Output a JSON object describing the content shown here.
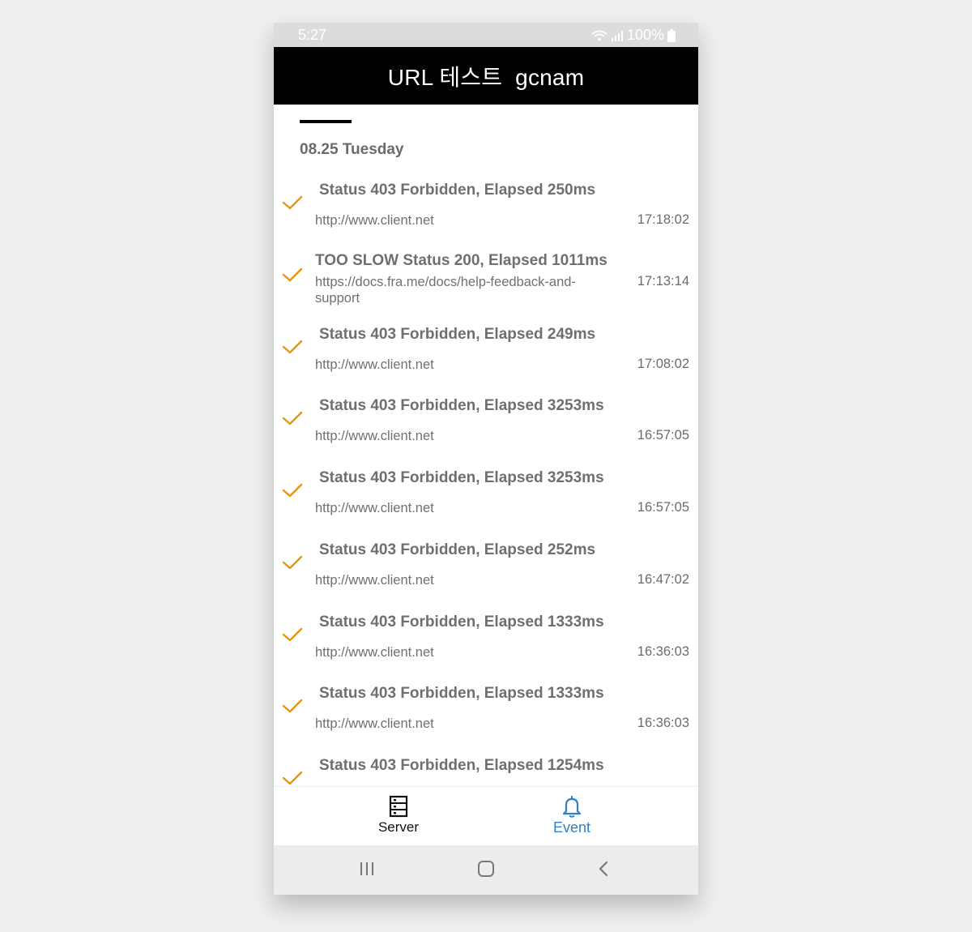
{
  "status_bar": {
    "time": "5:27",
    "battery": "100%"
  },
  "header": {
    "title": "URL 테스트  gcnam"
  },
  "date_header": "08.25 Tuesday",
  "events": [
    {
      "title": "Status 403 Forbidden, Elapsed 250ms",
      "url": "http://www.client.net",
      "time": "17:18:02"
    },
    {
      "title": "TOO SLOW Status 200, Elapsed 1011ms",
      "url": "https://docs.fra.me/docs/help-feedback-and-support",
      "time": "17:13:14"
    },
    {
      "title": "Status 403 Forbidden, Elapsed 249ms",
      "url": "http://www.client.net",
      "time": "17:08:02"
    },
    {
      "title": "Status 403 Forbidden, Elapsed 3253ms",
      "url": "http://www.client.net",
      "time": "16:57:05"
    },
    {
      "title": "Status 403 Forbidden, Elapsed 3253ms",
      "url": "http://www.client.net",
      "time": "16:57:05"
    },
    {
      "title": "Status 403 Forbidden, Elapsed 252ms",
      "url": "http://www.client.net",
      "time": "16:47:02"
    },
    {
      "title": "Status 403 Forbidden, Elapsed 1333ms",
      "url": "http://www.client.net",
      "time": "16:36:03"
    },
    {
      "title": "Status 403 Forbidden, Elapsed 1333ms",
      "url": "http://www.client.net",
      "time": "16:36:03"
    },
    {
      "title": "Status 403 Forbidden, Elapsed 1254ms",
      "url": "",
      "time": ""
    }
  ],
  "bottom_nav": {
    "server_label": "Server",
    "event_label": "Event",
    "active": "Event"
  },
  "colors": {
    "check": "#e8950f",
    "accent": "#2d82c8",
    "header_bg": "#000000"
  },
  "icons": {
    "check": "check-icon",
    "server": "server-icon",
    "event": "bell-icon",
    "recents": "recents-icon",
    "home": "home-icon",
    "back": "back-icon",
    "wifi": "wifi-icon",
    "signal": "signal-icon",
    "battery": "battery-icon"
  }
}
